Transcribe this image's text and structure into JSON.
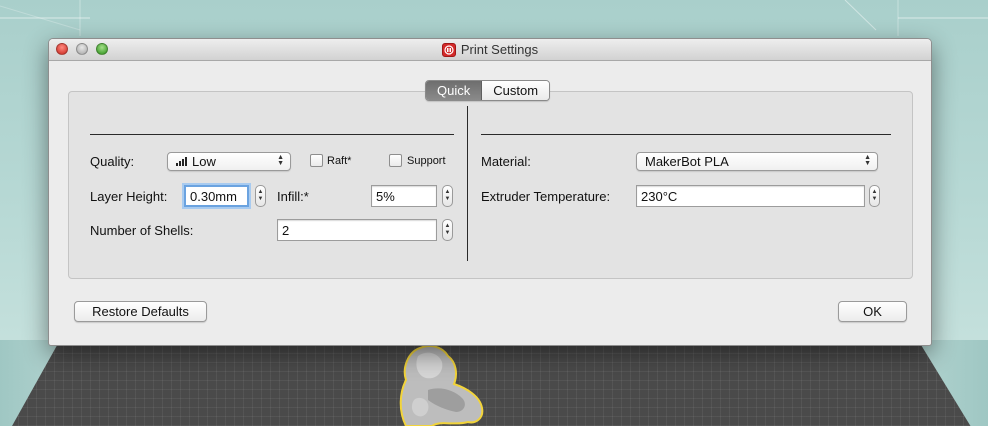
{
  "window": {
    "title": "Print Settings"
  },
  "tabs": [
    {
      "label": "Quick",
      "active": true
    },
    {
      "label": "Custom",
      "active": false
    }
  ],
  "left": {
    "quality_label": "Quality:",
    "quality_value": "Low",
    "raft_label": "Raft*",
    "support_label": "Support",
    "raft_checked": false,
    "support_checked": false,
    "layer_height_label": "Layer Height:",
    "layer_height_value": "0.30mm",
    "infill_label": "Infill:*",
    "infill_value": "5%",
    "shells_label": "Number of Shells:",
    "shells_value": "2"
  },
  "right": {
    "material_label": "Material:",
    "material_value": "MakerBot PLA",
    "extruder_label": "Extruder Temperature:",
    "extruder_value": "230°C"
  },
  "buttons": {
    "restore_label": "Restore Defaults",
    "ok_label": "OK"
  },
  "colors": {
    "accent_focus": "#6ba3e0",
    "app_icon": "#d32a2a",
    "highlight_outline": "#f2d43a"
  }
}
